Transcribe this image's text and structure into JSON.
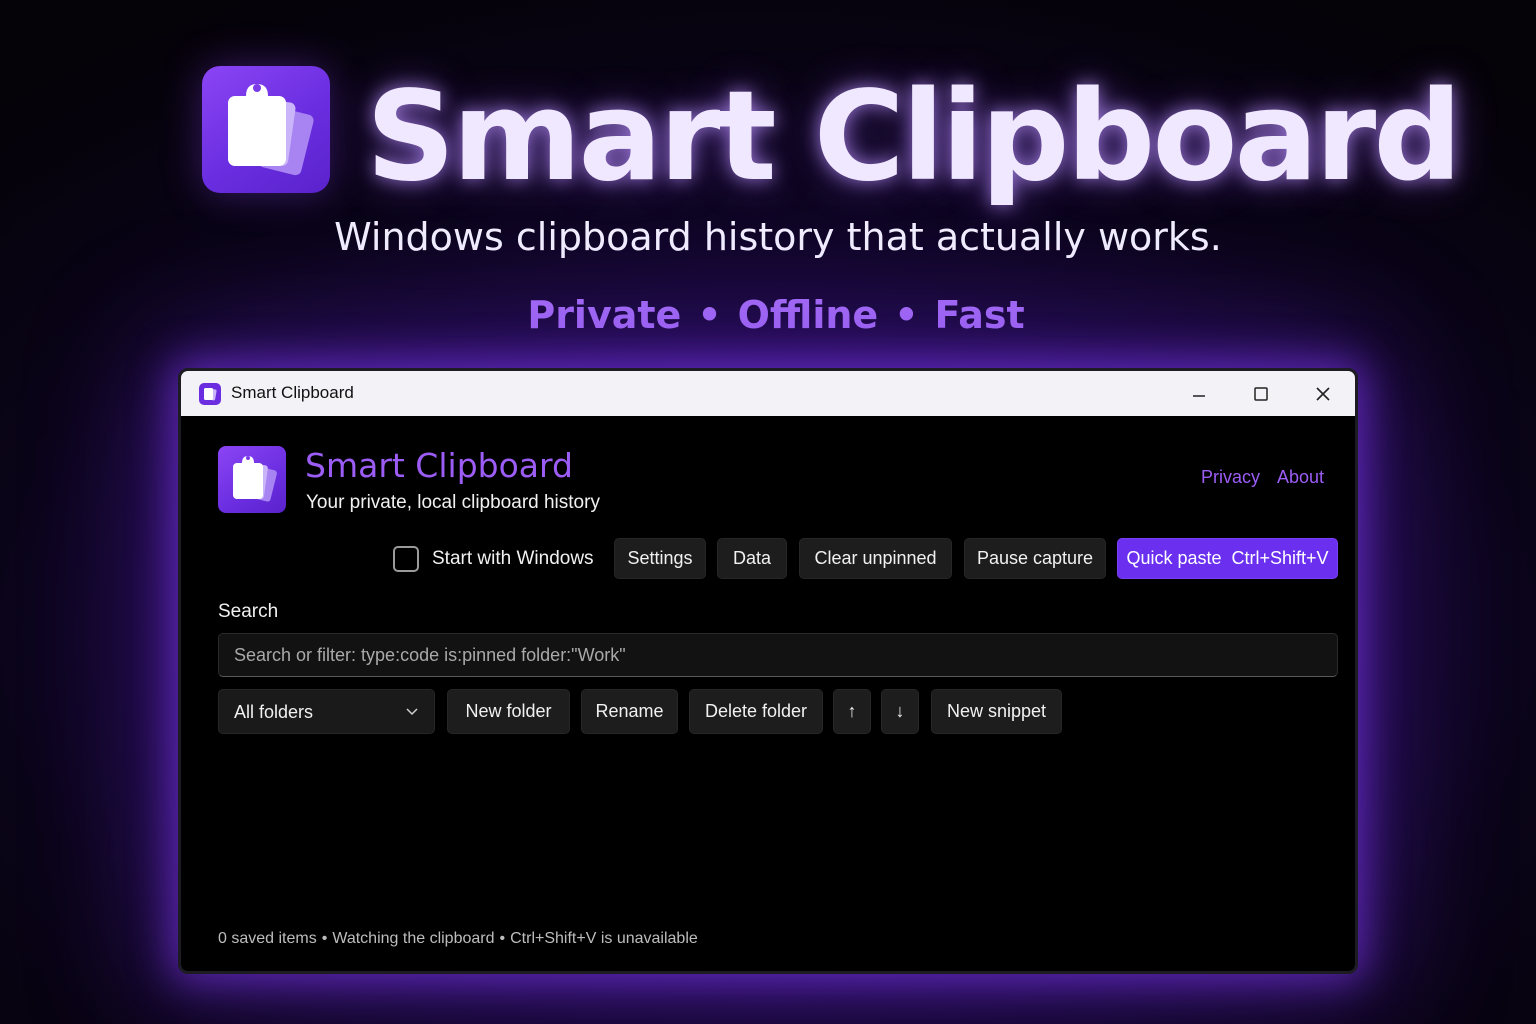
{
  "hero": {
    "title": "Smart Clipboard",
    "subtitle": "Windows clipboard history that actually works.",
    "tagline": [
      "Private",
      "Offline",
      "Fast"
    ],
    "tagline_separator": "•",
    "logo_icon": "clipboard-icon"
  },
  "window": {
    "title": "Smart Clipboard",
    "controls": [
      "minimize-icon",
      "maximize-icon",
      "close-icon"
    ]
  },
  "app": {
    "title": "Smart Clipboard",
    "subtitle": "Your private, local clipboard history",
    "links": {
      "privacy": "Privacy",
      "about": "About"
    }
  },
  "toolbar": {
    "start_with_windows": {
      "label": "Start with Windows",
      "checked": false
    },
    "settings": "Settings",
    "data": "Data",
    "clear_unpinned": "Clear unpinned",
    "pause_capture": "Pause capture",
    "quick_paste": "Quick paste  Ctrl+Shift+V"
  },
  "search": {
    "label": "Search",
    "placeholder": "Search or filter: type:code is:pinned folder:\"Work\"",
    "value": ""
  },
  "folders": {
    "selected": "All folders",
    "new_folder": "New folder",
    "rename": "Rename",
    "delete_folder": "Delete folder",
    "move_up": "↑",
    "move_down": "↓",
    "new_snippet": "New snippet"
  },
  "status": {
    "items": "0 saved items",
    "watching": "Watching the clipboard",
    "hotkey": "Ctrl+Shift+V is unavailable",
    "separator": "•"
  },
  "colors": {
    "accent": "#6b2ff0",
    "accent_text": "#9c5cf6",
    "tagline": "#a56ef5",
    "background": "#000000"
  }
}
